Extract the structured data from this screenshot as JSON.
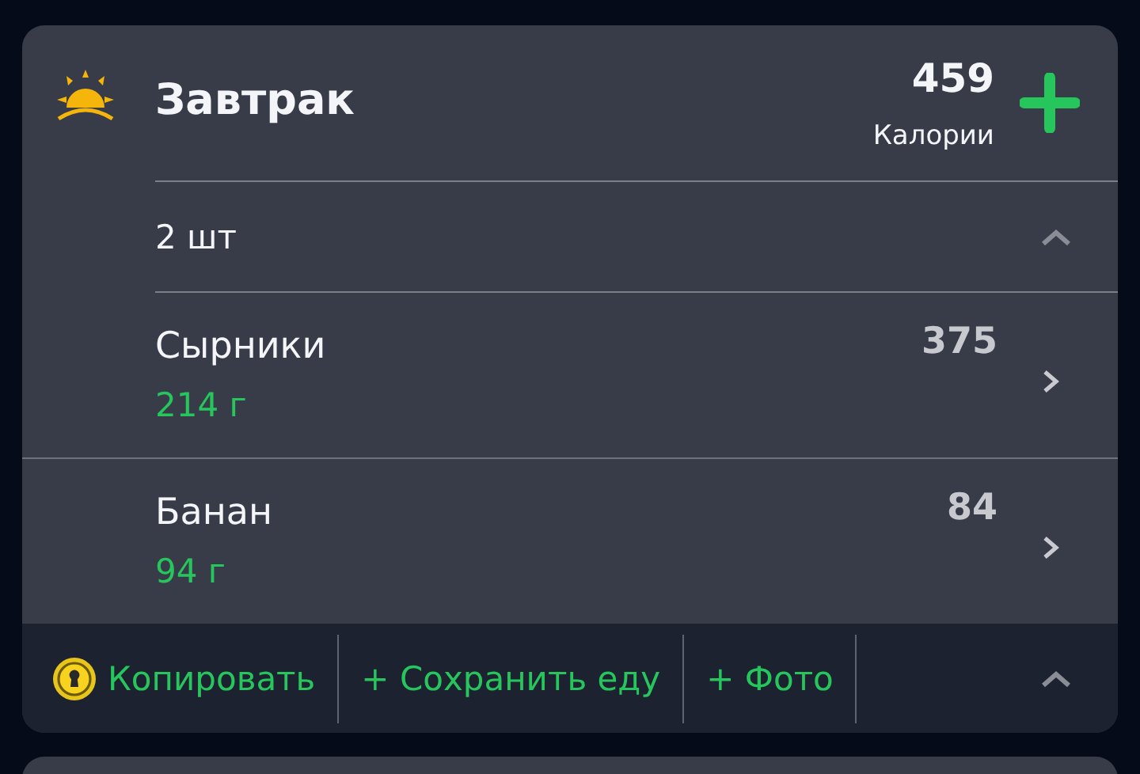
{
  "meal": {
    "title": "Завтрак",
    "calories": "459",
    "calories_label": "Калории"
  },
  "servings": {
    "label": "2 шт",
    "expanded": true
  },
  "items": [
    {
      "name": "Сырники",
      "weight": "214 г",
      "calories": "375"
    },
    {
      "name": "Банан",
      "weight": "94 г",
      "calories": "84"
    }
  ],
  "footer": {
    "actions": [
      {
        "label": "Копировать",
        "kind": "copy"
      },
      {
        "label": "+ Сохранить еду",
        "kind": "text"
      },
      {
        "label": "+ Фото",
        "kind": "text"
      }
    ],
    "expanded": true
  }
}
